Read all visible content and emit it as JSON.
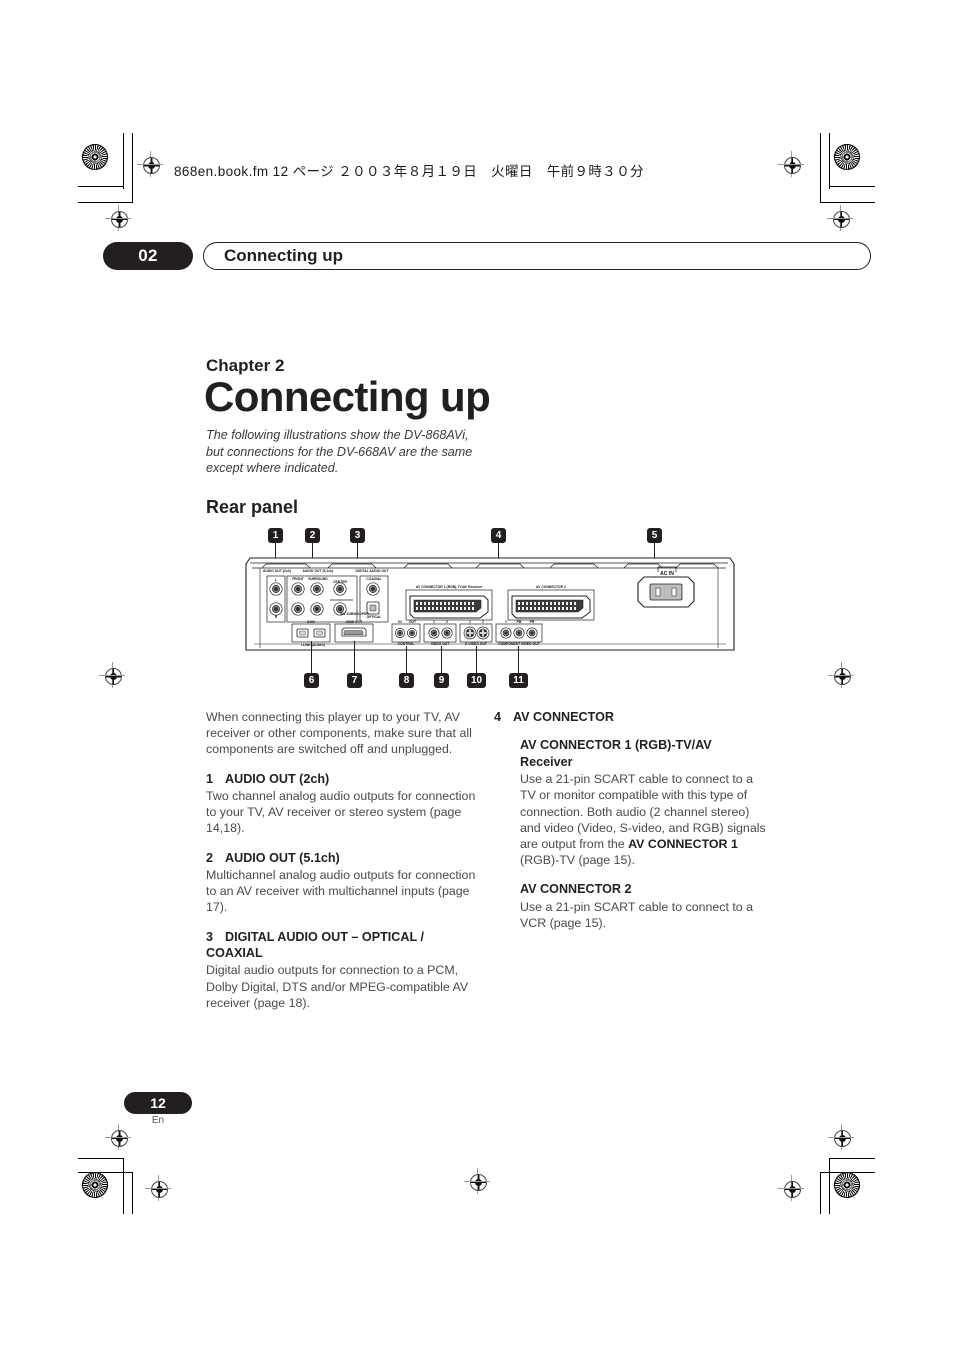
{
  "print_marks": {
    "file_header": "868en.book.fm  12 ページ  ２００３年８月１９日　火曜日　午前９時３０分"
  },
  "running_head": {
    "chapter_number": "02",
    "chapter_name": "Connecting up"
  },
  "chapter": {
    "label": "Chapter 2",
    "title": "Connecting up",
    "intro": "The following illustrations show the DV-868AVi, but connections for the DV-668AV are the same except where indicated.",
    "section_title": "Rear panel"
  },
  "figure": {
    "callouts": [
      {
        "id": "1",
        "label": "1"
      },
      {
        "id": "2",
        "label": "2"
      },
      {
        "id": "3",
        "label": "3"
      },
      {
        "id": "4",
        "label": "4"
      },
      {
        "id": "5",
        "label": "5"
      },
      {
        "id": "6",
        "label": "6"
      },
      {
        "id": "7",
        "label": "7"
      },
      {
        "id": "8",
        "label": "8"
      },
      {
        "id": "9",
        "label": "9"
      },
      {
        "id": "10",
        "label": "10"
      },
      {
        "id": "11",
        "label": "11"
      }
    ],
    "panel_labels": {
      "audio_out_2ch": "AUDIO OUT (2ch)",
      "audio_out_51ch": "AUDIO OUT (5.1ch)",
      "digital_audio_out": "DIGITAL AUDIO OUT",
      "front": "FRONT",
      "surround": "SURROUND",
      "center": "CENTER",
      "sw_subwoofer": "SW SUBWOOFER",
      "coaxial": "COAXIAL",
      "optical": "OPTICAL",
      "left": "L",
      "right": "R",
      "s400": "S400",
      "ilink_audio": "i.LINK (AUDIO)",
      "hdmi_out": "HDMI OUT",
      "control_in": "IN",
      "control_out": "OUT",
      "control": "CONTROL",
      "video_out": "VIDEO OUT",
      "video_1": "1",
      "video_2": "2",
      "s_video_out": "S-VIDEO OUT",
      "s_video_1": "1",
      "s_video_2": "2",
      "component_video_out": "COMPONENT VIDEO OUT",
      "comp_y": "Y",
      "comp_pb": "PB",
      "comp_pr": "PR",
      "av_connector_1": "AV CONNECTOR 1 (RGB)-TV/AV Receiver",
      "av_connector_2": "AV CONNECTOR 2",
      "ac_in": "AC IN"
    }
  },
  "body": {
    "left_column": {
      "intro": "When connecting this player up to your TV, AV receiver or other components, make sure that all components are switched off and unplugged.",
      "items": [
        {
          "number": "1",
          "heading": "AUDIO OUT (2ch)",
          "text": "Two channel analog audio outputs for connection to your TV, AV receiver or stereo system (page 14,18)."
        },
        {
          "number": "2",
          "heading": "AUDIO OUT (5.1ch)",
          "text": "Multichannel analog audio outputs for connection to an AV receiver with multichannel inputs (page 17)."
        },
        {
          "number": "3",
          "heading": "DIGITAL AUDIO OUT – OPTICAL / COAXIAL",
          "text": "Digital audio outputs for connection to a PCM, Dolby Digital, DTS and/or MPEG-compatible AV receiver (page 18)."
        }
      ]
    },
    "right_column": {
      "items": [
        {
          "number": "4",
          "heading": "AV CONNECTOR",
          "subsections": [
            {
              "heading": "AV CONNECTOR 1 (RGB)-TV/AV Receiver",
              "text_before_bold": "Use a 21-pin SCART cable to connect to a TV or monitor compatible with this type of connection. Both audio (2 channel stereo) and video (Video, S-video, and RGB) signals are output from the ",
              "bold_text": "AV CONNECTOR 1",
              "text_after_bold": " (RGB)-TV (page 15)."
            },
            {
              "heading": "AV CONNECTOR 2",
              "text_before_bold": "Use a 21-pin SCART cable to connect to a VCR (page 15).",
              "bold_text": "",
              "text_after_bold": ""
            }
          ]
        }
      ]
    }
  },
  "footer": {
    "page_number": "12",
    "language": "En"
  }
}
